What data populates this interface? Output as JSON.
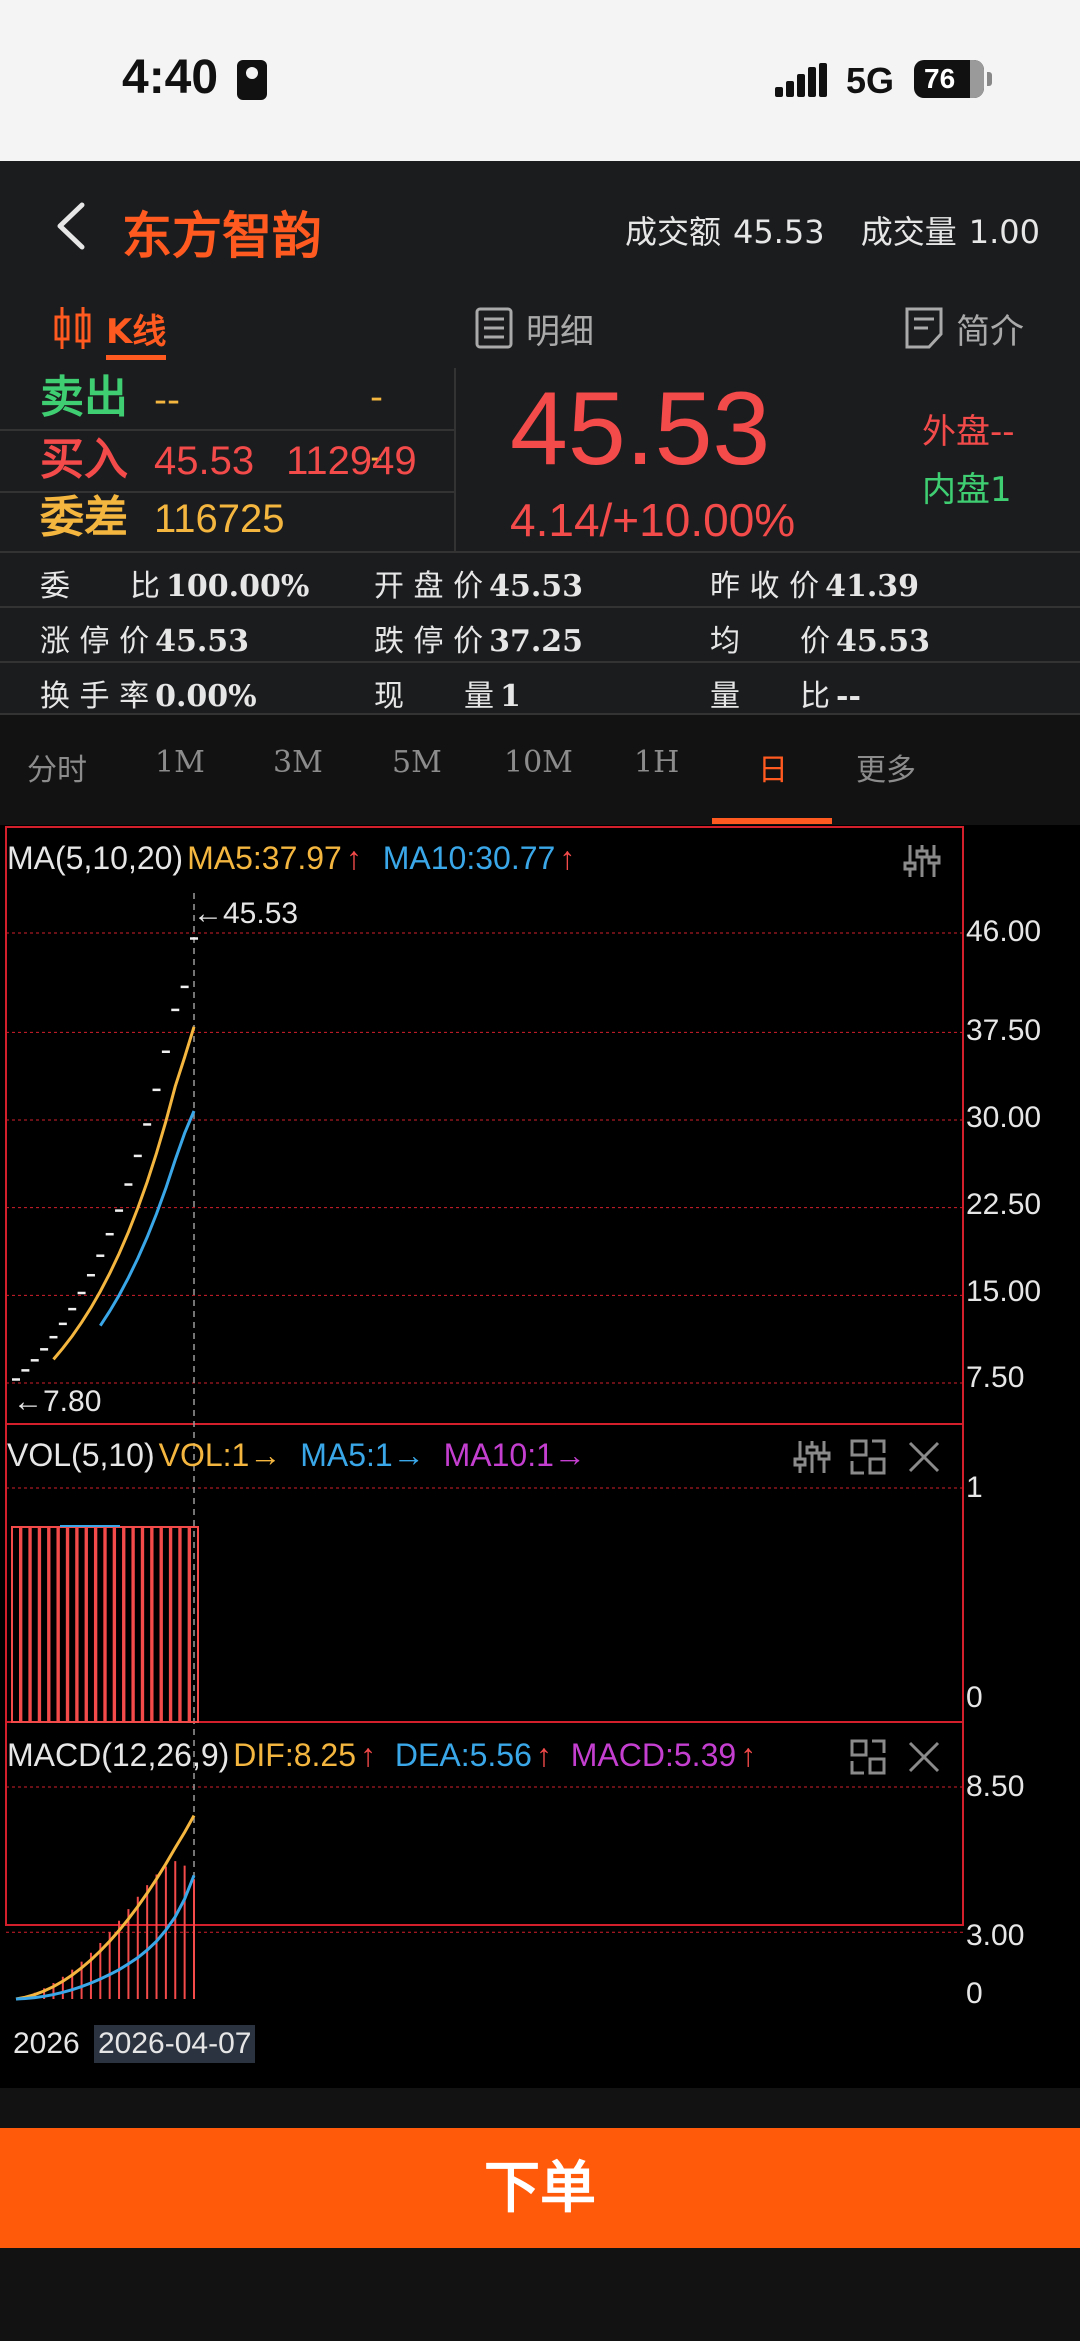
{
  "status_bar": {
    "time": "4:40",
    "network": "5G",
    "battery": "76"
  },
  "header": {
    "stock_name": "东方智韵",
    "turnover_label": "成交额",
    "turnover_value": "45.53",
    "volume_label": "成交量",
    "volume_value": "1.00"
  },
  "tabs": [
    {
      "label": "K线",
      "icon": "candlestick-icon",
      "active": true
    },
    {
      "label": "明细",
      "icon": "list-icon",
      "active": false
    },
    {
      "label": "简介",
      "icon": "document-icon",
      "active": false
    }
  ],
  "quote": {
    "sell_label": "卖出",
    "sell_price": "--",
    "sell_volume": "--",
    "buy_label": "买入",
    "buy_price": "45.53",
    "buy_volume": "112949",
    "diff_label": "委差",
    "diff_value": "116725",
    "price": "45.53",
    "change": "4.14/+10.00%",
    "outer_label": "外盘--",
    "inner_label": "内盘1"
  },
  "info_rows": [
    [
      {
        "label": "委　　比",
        "value": "100.00%"
      },
      {
        "label": "开 盘 价",
        "value": "45.53"
      },
      {
        "label": "昨 收 价",
        "value": "41.39"
      }
    ],
    [
      {
        "label": "涨 停 价",
        "value": "45.53"
      },
      {
        "label": "跌 停 价",
        "value": "37.25"
      },
      {
        "label": "均　　价",
        "value": "45.53"
      }
    ],
    [
      {
        "label": "换 手 率",
        "value": "0.00%"
      },
      {
        "label": "现　　量",
        "value": "1"
      },
      {
        "label": "量　　比",
        "value": "--"
      }
    ]
  ],
  "periods": [
    "分时",
    "1M",
    "3M",
    "5M",
    "10M",
    "1H",
    "日",
    "更多"
  ],
  "active_period": "日",
  "colors": {
    "accent": "#ff5a1f",
    "up": "#f34a4a",
    "down": "#3fcf72",
    "ma5": "#f4b63f",
    "ma10": "#3aa7e8",
    "ma20": "#c43fcf"
  },
  "main_chart": {
    "legend_name": "MA(5,10,20)",
    "ma5": "MA5:37.97",
    "ma10": "MA10:30.77",
    "up_arrow": "↑",
    "high_pointer": "←45.53",
    "low_pointer": "←7.80"
  },
  "vol_chart": {
    "legend_name": "VOL(5,10)",
    "vol": "VOL:1→",
    "ma5": "MA5:1→",
    "ma10": "MA10:1→"
  },
  "macd_chart": {
    "legend_name": "MACD(12,26,9)",
    "dif": "DIF:8.25",
    "dea": "DEA:5.56",
    "macd": "MACD:5.39",
    "up_arrow": "↑"
  },
  "chart_data": {
    "type": "line",
    "price_axis_ticks": [
      "46.00",
      "37.50",
      "30.00",
      "22.50",
      "15.00",
      "7.50"
    ],
    "price_ylim": [
      7.5,
      46.0
    ],
    "price_bars": [
      7.8,
      8.58,
      9.44,
      10.38,
      11.42,
      12.56,
      13.82,
      15.2,
      16.72,
      18.39,
      20.23,
      22.25,
      24.48,
      26.93,
      29.62,
      32.58,
      35.84,
      39.42,
      41.39,
      45.53
    ],
    "ma5": [
      null,
      null,
      null,
      null,
      9.52,
      10.48,
      11.52,
      12.68,
      13.94,
      15.34,
      16.87,
      18.56,
      20.41,
      22.46,
      24.7,
      27.17,
      29.89,
      32.88,
      35.37,
      37.97
    ],
    "ma10": [
      null,
      null,
      null,
      null,
      null,
      null,
      null,
      null,
      null,
      12.4,
      13.64,
      15.0,
      16.51,
      18.16,
      19.98,
      21.98,
      24.18,
      26.6,
      28.87,
      30.77
    ],
    "vol_axis_ticks": [
      "1",
      "0"
    ],
    "vol_ylim": [
      0,
      1
    ],
    "volume": [
      1,
      1,
      1,
      1,
      1,
      1,
      1,
      1,
      1,
      1,
      1,
      1,
      1,
      1,
      1,
      1,
      1,
      1,
      1,
      1
    ],
    "macd_axis_ticks": [
      "8.50",
      "3.00",
      "0"
    ],
    "macd_ylim": [
      0,
      8.5
    ],
    "dif": [
      0.0,
      0.08,
      0.2,
      0.36,
      0.56,
      0.8,
      1.08,
      1.4,
      1.76,
      2.16,
      2.6,
      3.08,
      3.6,
      4.16,
      4.76,
      5.4,
      6.08,
      6.8,
      7.5,
      8.25
    ],
    "dea": [
      0.0,
      0.02,
      0.06,
      0.12,
      0.2,
      0.3,
      0.42,
      0.56,
      0.72,
      0.9,
      1.1,
      1.32,
      1.58,
      1.86,
      2.2,
      2.6,
      3.1,
      3.7,
      4.5,
      5.56
    ],
    "macd_hist": [
      0.0,
      0.12,
      0.28,
      0.48,
      0.72,
      1.0,
      1.32,
      1.68,
      2.08,
      2.52,
      3.0,
      3.52,
      4.04,
      4.6,
      5.12,
      5.6,
      5.96,
      6.2,
      6.0,
      5.39
    ],
    "x_labels": [
      "2026",
      "2026-04-07"
    ]
  },
  "order_button": "下单"
}
